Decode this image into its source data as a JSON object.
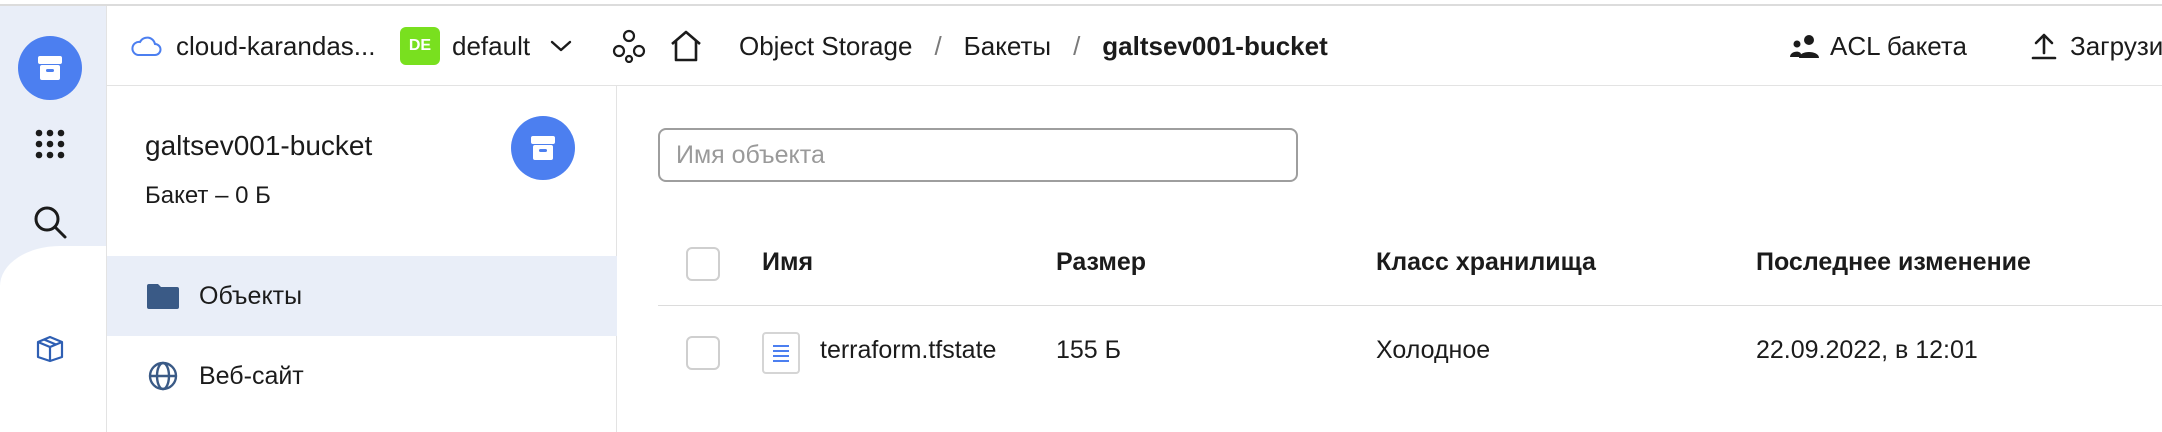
{
  "header": {
    "cloud_name": "cloud-karandas...",
    "folder_badge": "DE",
    "folder_name": "default",
    "breadcrumb": {
      "service": "Object Storage",
      "separator": "/",
      "buckets": "Бакеты",
      "current": "galtsev001-bucket"
    },
    "acl_label": "ACL бакета",
    "upload_label": "Загрузи"
  },
  "rail": {
    "icons": [
      "storage-icon",
      "apps-grid-icon",
      "search-icon",
      "box-icon"
    ]
  },
  "bucket": {
    "name": "galtsev001-bucket",
    "subtitle": "Бакет – 0 Б"
  },
  "nav": {
    "items": [
      {
        "label": "Объекты",
        "icon": "folder-icon",
        "active": true
      },
      {
        "label": "Веб-сайт",
        "icon": "globe-icon",
        "active": false
      }
    ]
  },
  "search": {
    "placeholder": "Имя объекта",
    "value": ""
  },
  "table": {
    "columns": [
      "Имя",
      "Размер",
      "Класс хранилища",
      "Последнее изменение"
    ],
    "rows": [
      {
        "name": "terraform.tfstate",
        "size": "155 Б",
        "storage_class": "Холодное",
        "modified": "22.09.2022, в 12:01"
      }
    ]
  },
  "colors": {
    "accent": "#4c7ff0",
    "badge": "#79e01f",
    "active_bg": "#e9eef8"
  }
}
